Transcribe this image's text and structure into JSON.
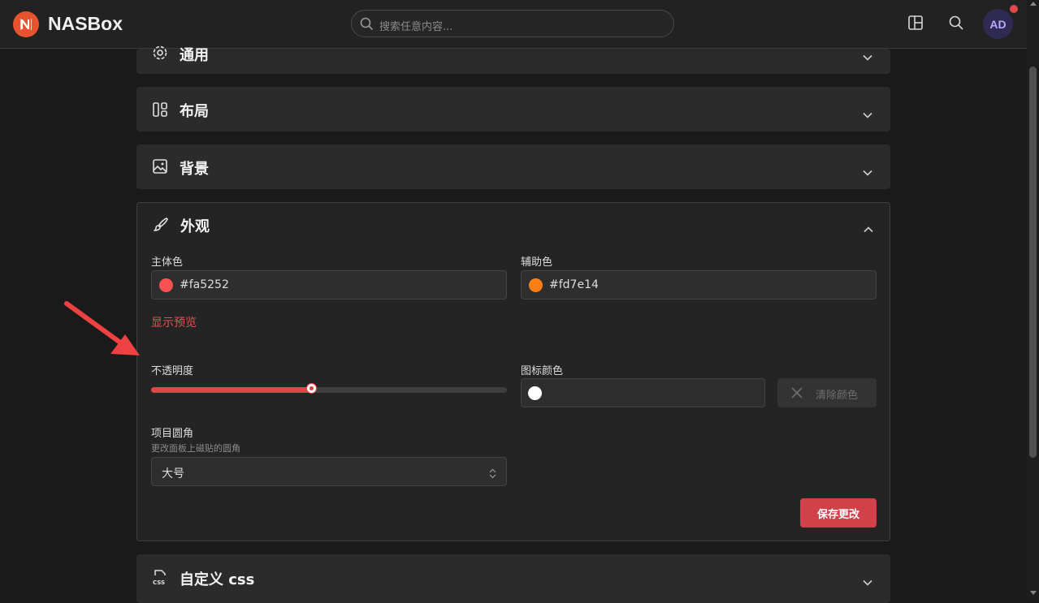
{
  "app": {
    "brand": "NASBox"
  },
  "search": {
    "placeholder": "搜索任意内容..."
  },
  "user": {
    "initials": "AD"
  },
  "sections": {
    "general": {
      "title": "通用"
    },
    "layout": {
      "title": "布局"
    },
    "background": {
      "title": "背景"
    },
    "appearance": {
      "title": "外观",
      "primary_color_label": "主体色",
      "primary_color_value": "#fa5252",
      "secondary_color_label": "辅助色",
      "secondary_color_value": "#fd7e14",
      "preview_link": "显示预览",
      "opacity_label": "不透明度",
      "opacity_value": 0.45,
      "icon_color_label": "图标颜色",
      "icon_color_value": "",
      "clear_color_button": "清除颜色",
      "radius_label": "项目圆角",
      "radius_hint": "更改面板上磁贴的圆角",
      "radius_value": "大号",
      "save_button": "保存更改"
    },
    "custom_css": {
      "title": "自定义 css"
    }
  },
  "colors": {
    "accent": "#fa5252",
    "secondary": "#fd7e14",
    "icon_color_swatch": "#ffffff",
    "brand_logo": "#e8542d",
    "notification_dot": "#e5484d"
  },
  "icons": [
    "brand-logo-icon",
    "search-icon",
    "layout-toggle-icon",
    "search-button-icon",
    "gear-icon",
    "layout-icon",
    "image-icon",
    "brush-icon",
    "css-file-icon",
    "chevron-down-icon",
    "chevron-up-icon",
    "close-icon",
    "selector-icon"
  ]
}
